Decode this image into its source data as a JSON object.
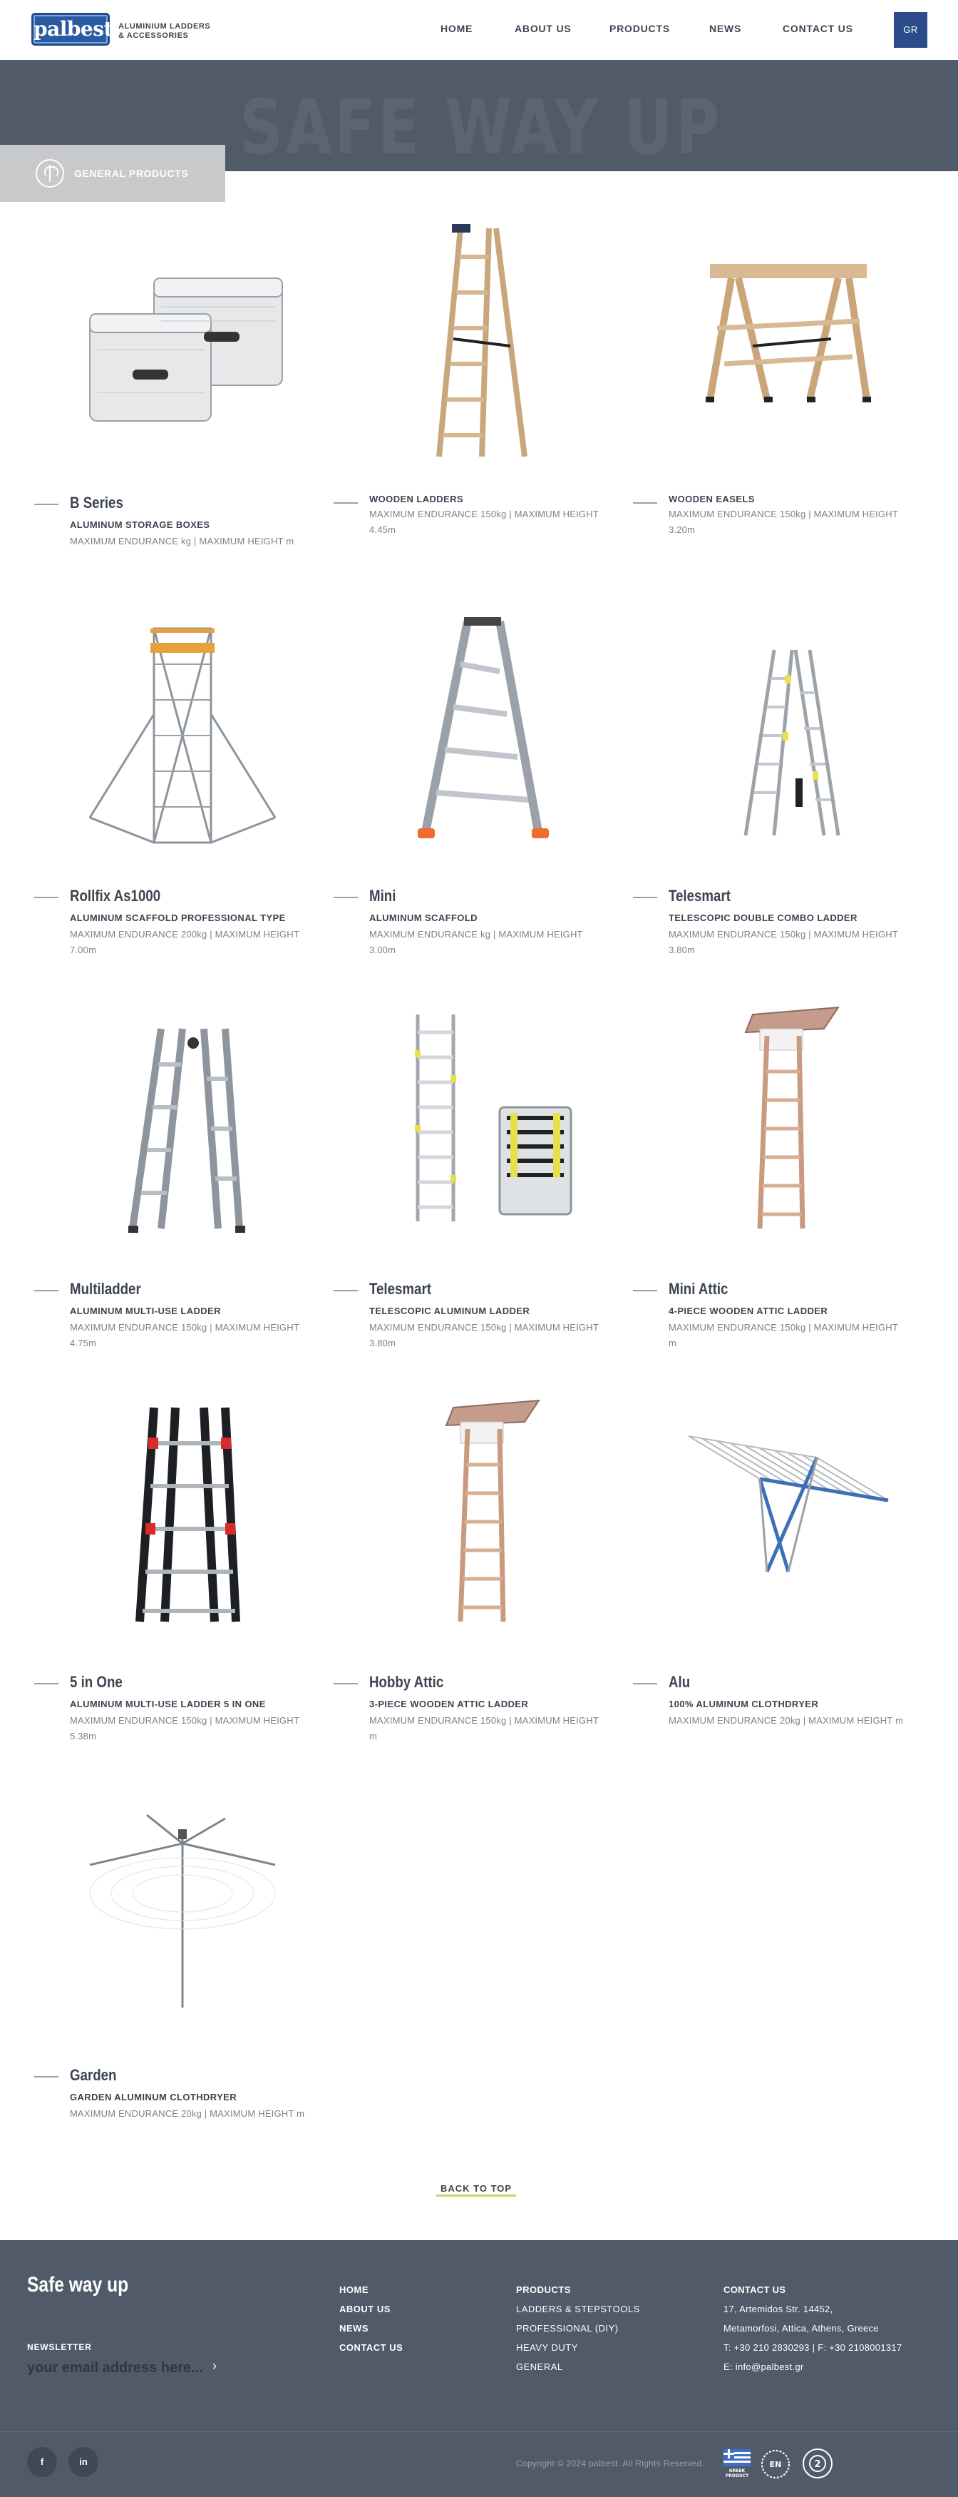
{
  "header": {
    "logo_text": "palbest",
    "tagline_line1": "ALUMINIUM LADDERS",
    "tagline_line2": "& ACCESSORIES",
    "nav": [
      "HOME",
      "ABOUT US",
      "PRODUCTS",
      "NEWS",
      "CONTACT US"
    ],
    "lang": "GR"
  },
  "banner": {
    "title": "SAFE WAY UP",
    "category": "GENERAL PRODUCTS"
  },
  "products": [
    {
      "name": "B Series",
      "subtitle": "ALUMINUM STORAGE BOXES",
      "spec": "MAXIMUM ENDURANCE kg | MAXIMUM HEIGHT m",
      "icon": "storage-boxes"
    },
    {
      "name": "",
      "subtitle": "WOODEN LADDERS",
      "spec": "MAXIMUM ENDURANCE 150kg | MAXIMUM HEIGHT 4.45m",
      "icon": "wooden-ladder"
    },
    {
      "name": "",
      "subtitle": "WOODEN EASELS",
      "spec": "MAXIMUM ENDURANCE 150kg | MAXIMUM HEIGHT 3.20m",
      "icon": "wooden-easel"
    },
    {
      "name": "Rollfix As1000",
      "subtitle": "ALUMINUM SCAFFOLD PROFESSIONAL TYPE",
      "spec": "MAXIMUM ENDURANCE 200kg | MAXIMUM HEIGHT 7.00m",
      "icon": "scaffold"
    },
    {
      "name": "Mini",
      "subtitle": "ALUMINUM SCAFFOLD",
      "spec": "MAXIMUM ENDURANCE kg | MAXIMUM HEIGHT 3.00m",
      "icon": "a-frame-ladder"
    },
    {
      "name": "Telesmart",
      "subtitle": "TELESCOPIC DOUBLE COMBO LADDER",
      "spec": "MAXIMUM ENDURANCE 150kg | MAXIMUM HEIGHT 3.80m",
      "icon": "telescopic-combo"
    },
    {
      "name": "Multiladder",
      "subtitle": "ALUMINUM MULTI-USE LADDER",
      "spec": "MAXIMUM ENDURANCE 150kg | MAXIMUM HEIGHT 4.75m",
      "icon": "multi-ladder"
    },
    {
      "name": "Telesmart",
      "subtitle": "TELESCOPIC ALUMINUM LADDER",
      "spec": "MAXIMUM ENDURANCE 150kg | MAXIMUM HEIGHT 3.80m",
      "icon": "telescopic-ladder"
    },
    {
      "name": "Mini Attic",
      "subtitle": "4-PIECE WOODEN ATTIC LADDER",
      "spec": "MAXIMUM ENDURANCE 150kg | MAXIMUM HEIGHT m",
      "icon": "attic-ladder"
    },
    {
      "name": "5 in One",
      "subtitle": "ALUMINUM MULTI-USE LADDER 5 IN ONE",
      "spec": "MAXIMUM ENDURANCE 150kg | MAXIMUM HEIGHT 5.38m",
      "icon": "five-in-one"
    },
    {
      "name": "Hobby Attic",
      "subtitle": "3-PIECE WOODEN ATTIC LADDER",
      "spec": "MAXIMUM ENDURANCE 150kg | MAXIMUM HEIGHT m",
      "icon": "attic-ladder"
    },
    {
      "name": "Alu",
      "subtitle": "100% ALUMINUM CLOTHDRYER",
      "spec": "MAXIMUM ENDURANCE 20kg | MAXIMUM HEIGHT m",
      "icon": "clothdryer"
    },
    {
      "name": "Garden",
      "subtitle": "GARDEN ALUMINUM CLOTHDRYER",
      "spec": "MAXIMUM ENDURANCE 20kg | MAXIMUM HEIGHT m",
      "icon": "garden-dryer"
    }
  ],
  "back_to_top": "BACK TO TOP",
  "footer": {
    "title": "Safe way up",
    "newsletter_label": "NEWSLETTER",
    "newsletter_placeholder": "your email address here...",
    "links": [
      "HOME",
      "ABOUT US",
      "NEWS",
      "CONTACT US"
    ],
    "products_heading": "PRODUCTS",
    "products_links": [
      "LADDERS & STEPSTOOLS",
      "PROFESSIONAL (DIY)",
      "HEAVY DUTY",
      "GENERAL"
    ],
    "contact_heading": "CONTACT US",
    "contact_lines": [
      "17, Artemidos Str. 14452,",
      "Metamorfosi, Attica, Athens, Greece",
      "T: +30 210 2830293 | F: +30 2108001317",
      "E: info@palbest.gr"
    ],
    "social": [
      "f",
      "in"
    ],
    "copyright": "Copyright © 2024 palbest. All Rights Reserved.",
    "badge_flag_text": "GREEK PRODUCT",
    "badge_en_text": "EN",
    "badge_2_text": "2"
  },
  "colors": {
    "brand_blue": "#2a5aa3",
    "slate": "#505a68",
    "accent_green": "#c3d66a"
  }
}
